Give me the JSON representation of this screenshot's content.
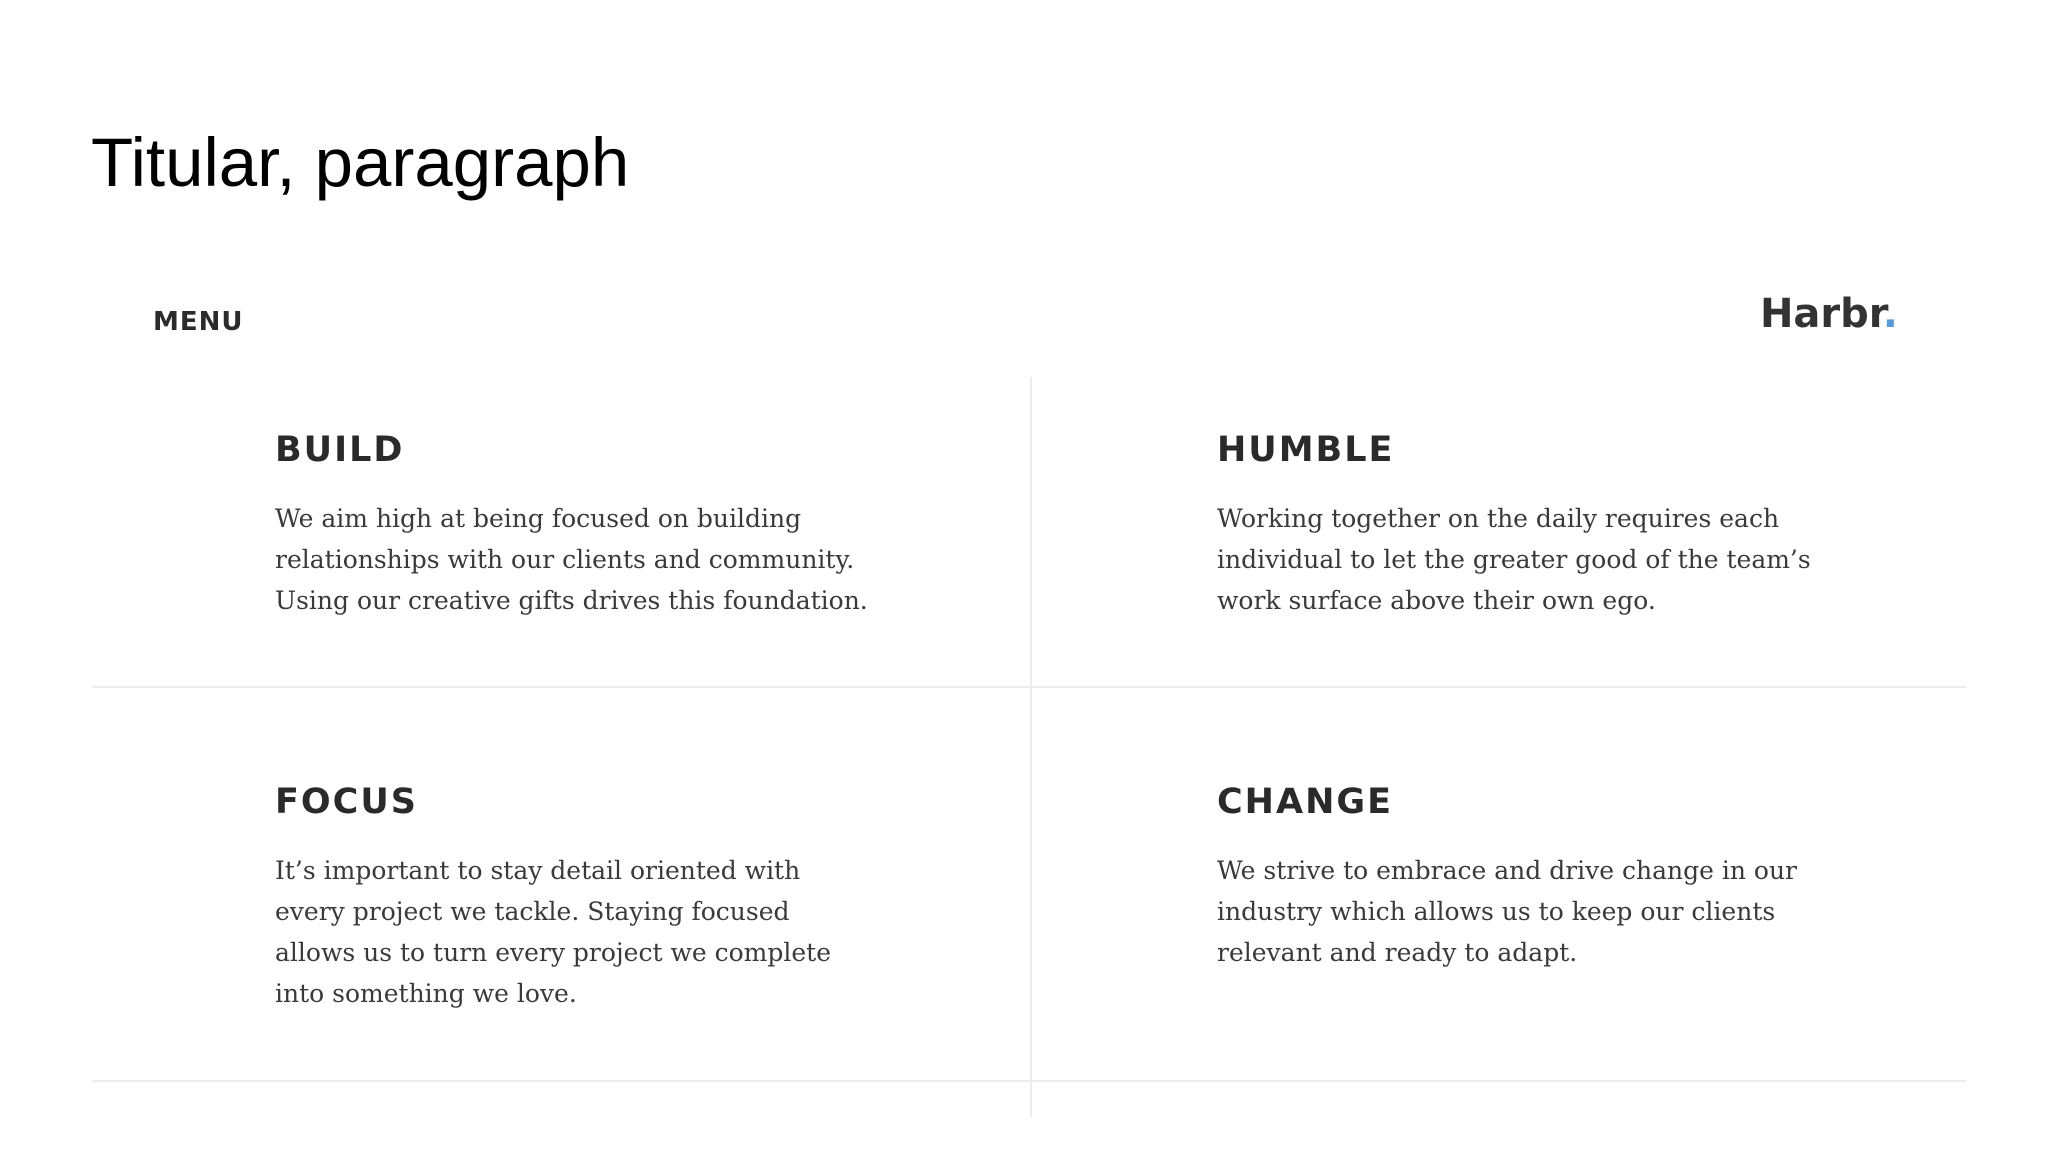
{
  "slide": {
    "title": "Titular, paragraph"
  },
  "header": {
    "menu_label": "MENU",
    "logo_text": "Harbr",
    "logo_dot": ".",
    "logo_dot_color": "#5b9bd5"
  },
  "values": [
    {
      "heading": "BUILD",
      "body": "We aim high at being focused on building relationships with our clients and community. Using our creative gifts drives this foundation."
    },
    {
      "heading": "HUMBLE",
      "body": "Working together on the daily requires each individual to let the greater good of the team’s work surface above their own ego."
    },
    {
      "heading": "FOCUS",
      "body": "It’s important to stay detail oriented with every project we tackle. Staying focused allows us to turn every project we complete into something we love."
    },
    {
      "heading": "CHANGE",
      "body": "We strive to embrace and drive change in our industry which allows us to keep our clients relevant and ready to adapt."
    }
  ]
}
